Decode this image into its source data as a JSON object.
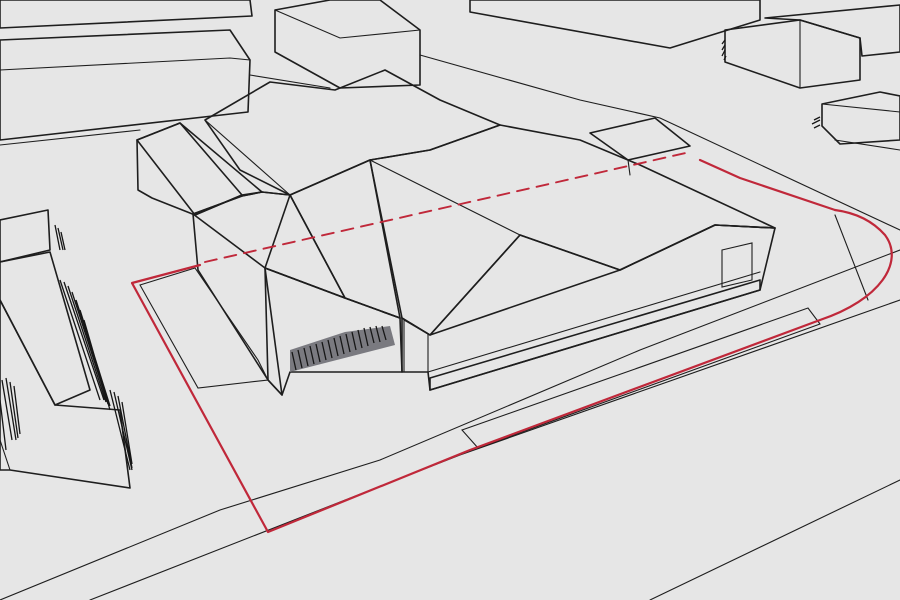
{
  "colors": {
    "background": "#ececec",
    "ground": "#e6e6e6",
    "ink": "#1e1e1e",
    "boundary": "#c0283a",
    "building_roof": "#b4b3b8",
    "building_roof_light": "#c1c0c5",
    "building_wall": "#bdbcc1",
    "building_wall_dark": "#a9a8ad",
    "door": "#3c3c44",
    "context_building": "#f5f5f5",
    "green_strip": "#e2ebe4"
  },
  "elements": {
    "subject_building": "grey-industrial-warehouse",
    "site_boundary": "red-solid-line",
    "dividing_line": "red-dashed-line",
    "landscaping": "green-strips",
    "context": "white-outline-buildings"
  }
}
